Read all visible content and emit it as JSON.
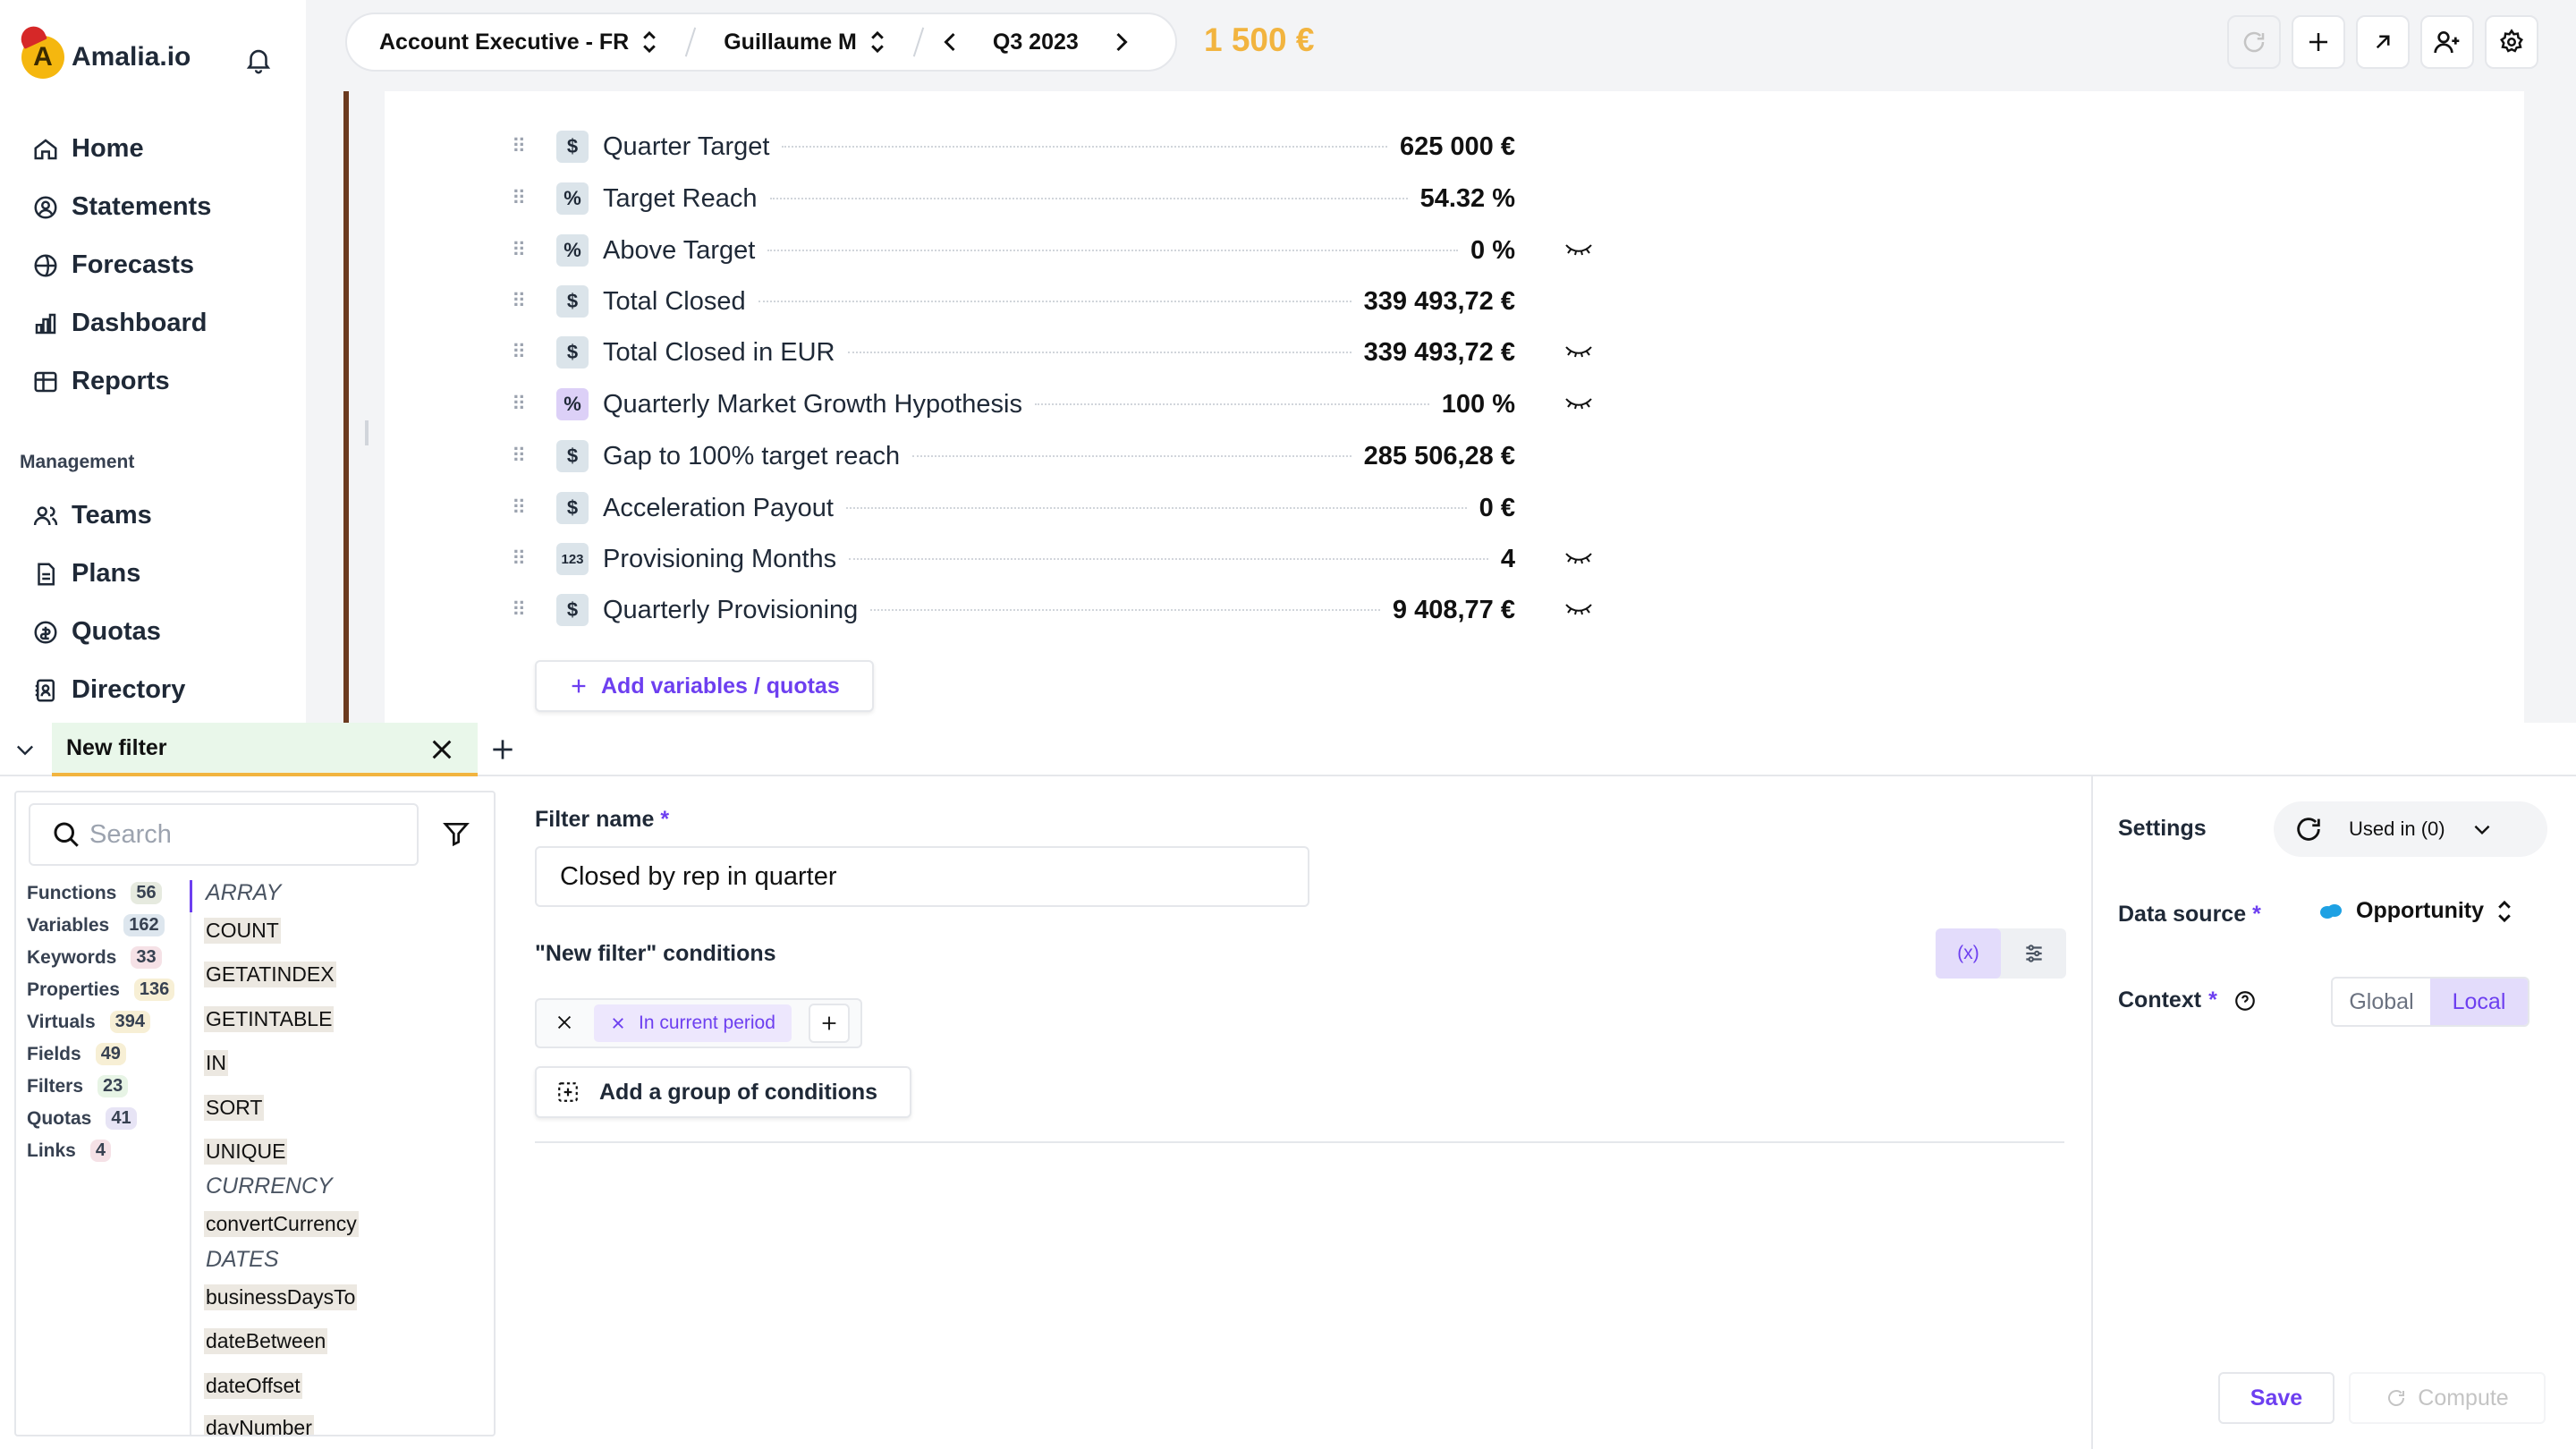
{
  "app": {
    "name": "Amalia.io"
  },
  "sidebar": {
    "items": [
      {
        "label": "Home",
        "icon": "home-icon"
      },
      {
        "label": "Statements",
        "icon": "user-circle-icon"
      },
      {
        "label": "Forecasts",
        "icon": "forecast-icon"
      },
      {
        "label": "Dashboard",
        "icon": "bar-chart-icon"
      },
      {
        "label": "Reports",
        "icon": "table-icon"
      }
    ],
    "management_label": "Management",
    "management_items": [
      {
        "label": "Teams",
        "icon": "users-icon"
      },
      {
        "label": "Plans",
        "icon": "file-icon"
      },
      {
        "label": "Quotas",
        "icon": "target-icon"
      },
      {
        "label": "Directory",
        "icon": "address-book-icon"
      }
    ]
  },
  "topbar": {
    "role": "Account Executive - FR",
    "user": "Guillaume M",
    "period": "Q3 2023",
    "amount": "1 500 €"
  },
  "variables": [
    {
      "name": "Quarter Target",
      "value": "625 000 €",
      "type": "$",
      "hidden": false
    },
    {
      "name": "Target Reach",
      "value": "54.32 %",
      "type": "%",
      "hidden": false
    },
    {
      "name": "Above Target",
      "value": "0 %",
      "type": "%",
      "hidden": true
    },
    {
      "name": "Total Closed",
      "value": "339 493,72 €",
      "type": "$",
      "hidden": false
    },
    {
      "name": "Total Closed in EUR",
      "value": "339 493,72 €",
      "type": "$",
      "hidden": true
    },
    {
      "name": "Quarterly Market Growth Hypothesis",
      "value": "100 %",
      "type": "%",
      "hidden": true,
      "accent": true
    },
    {
      "name": "Gap to 100% target reach",
      "value": "285 506,28 €",
      "type": "$",
      "hidden": false
    },
    {
      "name": "Acceleration Payout",
      "value": "0 €",
      "type": "$",
      "hidden": false
    },
    {
      "name": "Provisioning Months",
      "value": "4",
      "type": "123",
      "hidden": true
    },
    {
      "name": "Quarterly Provisioning",
      "value": "9 408,77 €",
      "type": "$",
      "hidden": true
    }
  ],
  "add_variables_label": "Add variables / quotas",
  "tab": {
    "label": "New filter"
  },
  "library": {
    "search_placeholder": "Search",
    "categories": [
      {
        "label": "Functions",
        "count": "56",
        "color": "#e6eadf"
      },
      {
        "label": "Variables",
        "count": "162",
        "color": "#dde6ee"
      },
      {
        "label": "Keywords",
        "count": "33",
        "color": "#f5e1e6"
      },
      {
        "label": "Properties",
        "count": "136",
        "color": "#f7efd5"
      },
      {
        "label": "Virtuals",
        "count": "394",
        "color": "#f7efd5"
      },
      {
        "label": "Fields",
        "count": "49",
        "color": "#f7efd5"
      },
      {
        "label": "Filters",
        "count": "23",
        "color": "#e7f4e5"
      },
      {
        "label": "Quotas",
        "count": "41",
        "color": "#e7e4f5"
      },
      {
        "label": "Links",
        "count": "4",
        "color": "#f5e1e6"
      }
    ],
    "groups": {
      "array": "ARRAY",
      "currency": "CURRENCY",
      "dates": "DATES"
    },
    "functions": {
      "count": "COUNT",
      "getatindex": "GETATINDEX",
      "getintable": "GETINTABLE",
      "in": "IN",
      "sort": "SORT",
      "unique": "UNIQUE",
      "convertCurrency": "convertCurrency",
      "businessDaysTo": "businessDaysTo",
      "dateBetween": "dateBetween",
      "dateOffset": "dateOffset",
      "dayNumber": "dayNumber"
    }
  },
  "filter": {
    "name_label": "Filter name",
    "required_mark": "*",
    "name_value": "Closed by rep in quarter",
    "conditions_label": "\"New filter\" conditions",
    "fx_label": "(x)",
    "chip_label": "In current period",
    "add_group_label": "Add a group of conditions"
  },
  "settings": {
    "title": "Settings",
    "used_in": "Used in (0)",
    "data_source_label": "Data source",
    "data_source_value": "Opportunity",
    "context_label": "Context",
    "context_global": "Global",
    "context_local": "Local",
    "save": "Save",
    "compute": "Compute"
  },
  "colors": {
    "accent": "#6d3ff0",
    "amount": "#f2b43f",
    "brand": "#f5b70f"
  }
}
